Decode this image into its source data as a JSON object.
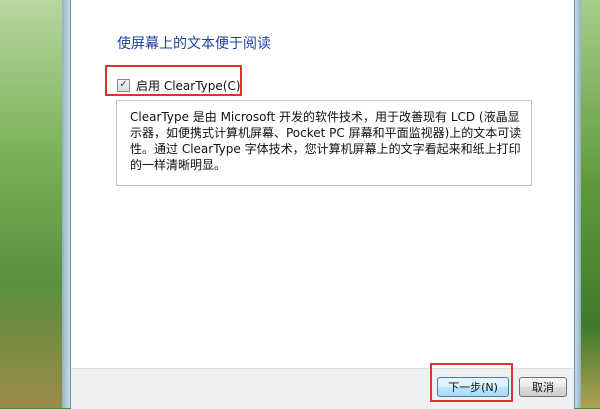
{
  "main": {
    "heading": "使屏幕上的文本便于阅读",
    "checkbox": {
      "checked": true,
      "check_glyph": "✓",
      "label": "启用 ClearType(C)"
    },
    "description": "ClearType 是由 Microsoft 开发的软件技术，用于改善现有 LCD (液晶显示器，如便携式计算机屏幕、Pocket PC 屏幕和平面监视器)上的文本可读性。通过 ClearType 字体技术，您计算机屏幕上的文字看起来和纸上打印的一样清晰明显。"
  },
  "footer": {
    "next_label": "下一步(N)",
    "cancel_label": "取消"
  },
  "colors": {
    "heading": "#1e3fa0",
    "highlight": "#e03030",
    "next_border": "#3c7fb1"
  }
}
